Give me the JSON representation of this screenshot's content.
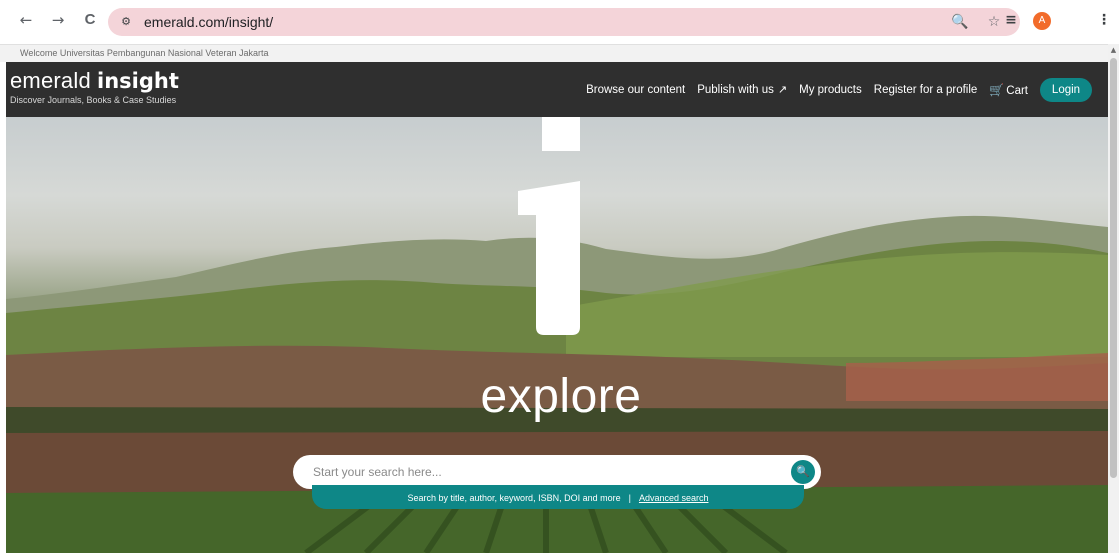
{
  "browser": {
    "url": "emerald.com/insight/",
    "back_icon": "←",
    "forward_icon": "→",
    "reload_icon": "C",
    "site_info_icon": "⚙",
    "zoom_icon": "🔍",
    "bookmark_icon": "☆",
    "media_icon": "≡",
    "avatar_letter": "A",
    "menu_icon": "⋮"
  },
  "welcome": "Welcome Universitas Pembangunan Nasional Veteran Jakarta",
  "header": {
    "logo_light": "emerald",
    "logo_bold": "insight",
    "tagline": "Discover Journals, Books & Case Studies",
    "nav": {
      "browse": "Browse our content",
      "publish": "Publish with us",
      "products": "My products",
      "register": "Register for a profile",
      "cart": "Cart",
      "login": "Login"
    }
  },
  "hero": {
    "heading": "explore",
    "search_placeholder": "Start your search here...",
    "help_text": "Search by title, author, keyword, ISBN, DOI and more",
    "separator": "|",
    "advanced_search": "Advanced search"
  },
  "colors": {
    "accent": "#0e8787",
    "header_bg": "#2f2f2f",
    "address_bar": "#f4d4d9",
    "avatar": "#f26b2a"
  }
}
